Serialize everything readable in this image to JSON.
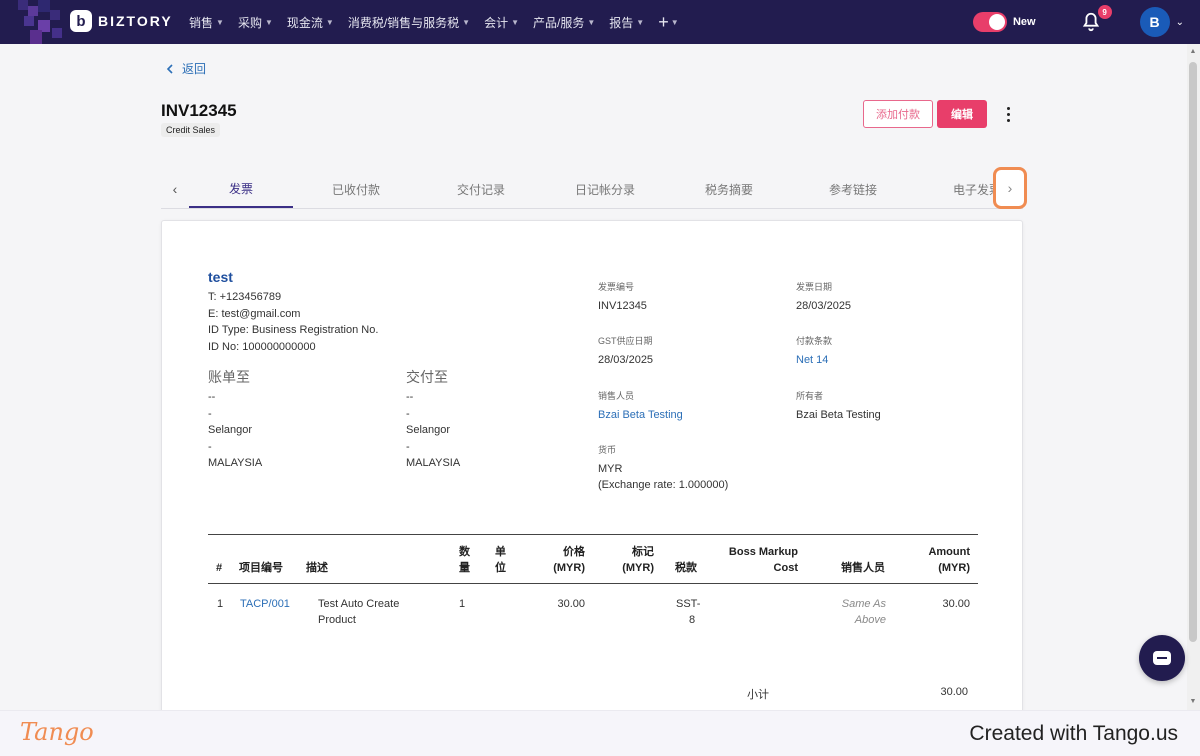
{
  "topbar": {
    "brand": "BIZTORY",
    "nav": [
      {
        "label": "销售"
      },
      {
        "label": "采购"
      },
      {
        "label": "现金流"
      },
      {
        "label": "消费税/销售与服务税"
      },
      {
        "label": "会计"
      },
      {
        "label": "产品/服务"
      },
      {
        "label": "报告"
      }
    ],
    "new_label": "New",
    "notification_count": "9",
    "avatar_initial": "B"
  },
  "page": {
    "back_label": "返回",
    "invoice_number": "INV12345",
    "badge": "Credit Sales",
    "add_payment_label": "添加付款",
    "edit_label": "编辑"
  },
  "tabs": [
    {
      "label": "发票",
      "active": true
    },
    {
      "label": "已收付款"
    },
    {
      "label": "交付记录"
    },
    {
      "label": "日记帐分录"
    },
    {
      "label": "税务摘要"
    },
    {
      "label": "参考链接"
    },
    {
      "label": "电子发票"
    }
  ],
  "company": {
    "name": "test",
    "lines": [
      "T: +123456789",
      "E: test@gmail.com",
      "ID Type: Business Registration No.",
      "ID No: 100000000000"
    ]
  },
  "billing": {
    "title": "账单至",
    "lines": [
      "--",
      "-",
      "Selangor",
      "-",
      "MALAYSIA"
    ]
  },
  "delivery": {
    "title": "交付至",
    "lines": [
      "--",
      "-",
      "Selangor",
      "-",
      "MALAYSIA"
    ]
  },
  "meta": {
    "invoice_no_label": "发票编号",
    "invoice_no": "INV12345",
    "invoice_date_label": "发票日期",
    "invoice_date": "28/03/2025",
    "gst_date_label": "GST供应日期",
    "gst_date": "28/03/2025",
    "terms_label": "付款条款",
    "terms": "Net 14",
    "salesperson_label": "销售人员",
    "salesperson": "Bzai Beta Testing",
    "owner_label": "所有者",
    "owner": "Bzai Beta Testing",
    "currency_label": "货币",
    "currency": "MYR",
    "exchange_rate": "(Exchange rate: 1.000000)"
  },
  "table": {
    "headers": {
      "no": "#",
      "code": "项目编号",
      "desc": "描述",
      "qty_1": "数",
      "qty_2": "量",
      "unit_1": "单",
      "unit_2": "位",
      "price_1": "价格",
      "price_2": "(MYR)",
      "markup_1": "标记",
      "markup_2": "(MYR)",
      "tax": "税款",
      "boss_1": "Boss Markup",
      "boss_2": "Cost",
      "salesperson": "销售人员",
      "amount_1": "Amount",
      "amount_2": "(MYR)"
    },
    "rows": [
      {
        "no": "1",
        "code": "TACP/001",
        "desc_1": "Test Auto Create",
        "desc_2": "Product",
        "qty": "1",
        "price": "30.00",
        "tax_1": "SST-",
        "tax_2": "8",
        "salesperson_1": "Same As",
        "salesperson_2": "Above",
        "amount": "30.00"
      }
    ],
    "subtotal_label": "小计",
    "subtotal": "30.00"
  },
  "footer": {
    "logo": "Tango",
    "credit": "Created with Tango.us"
  }
}
